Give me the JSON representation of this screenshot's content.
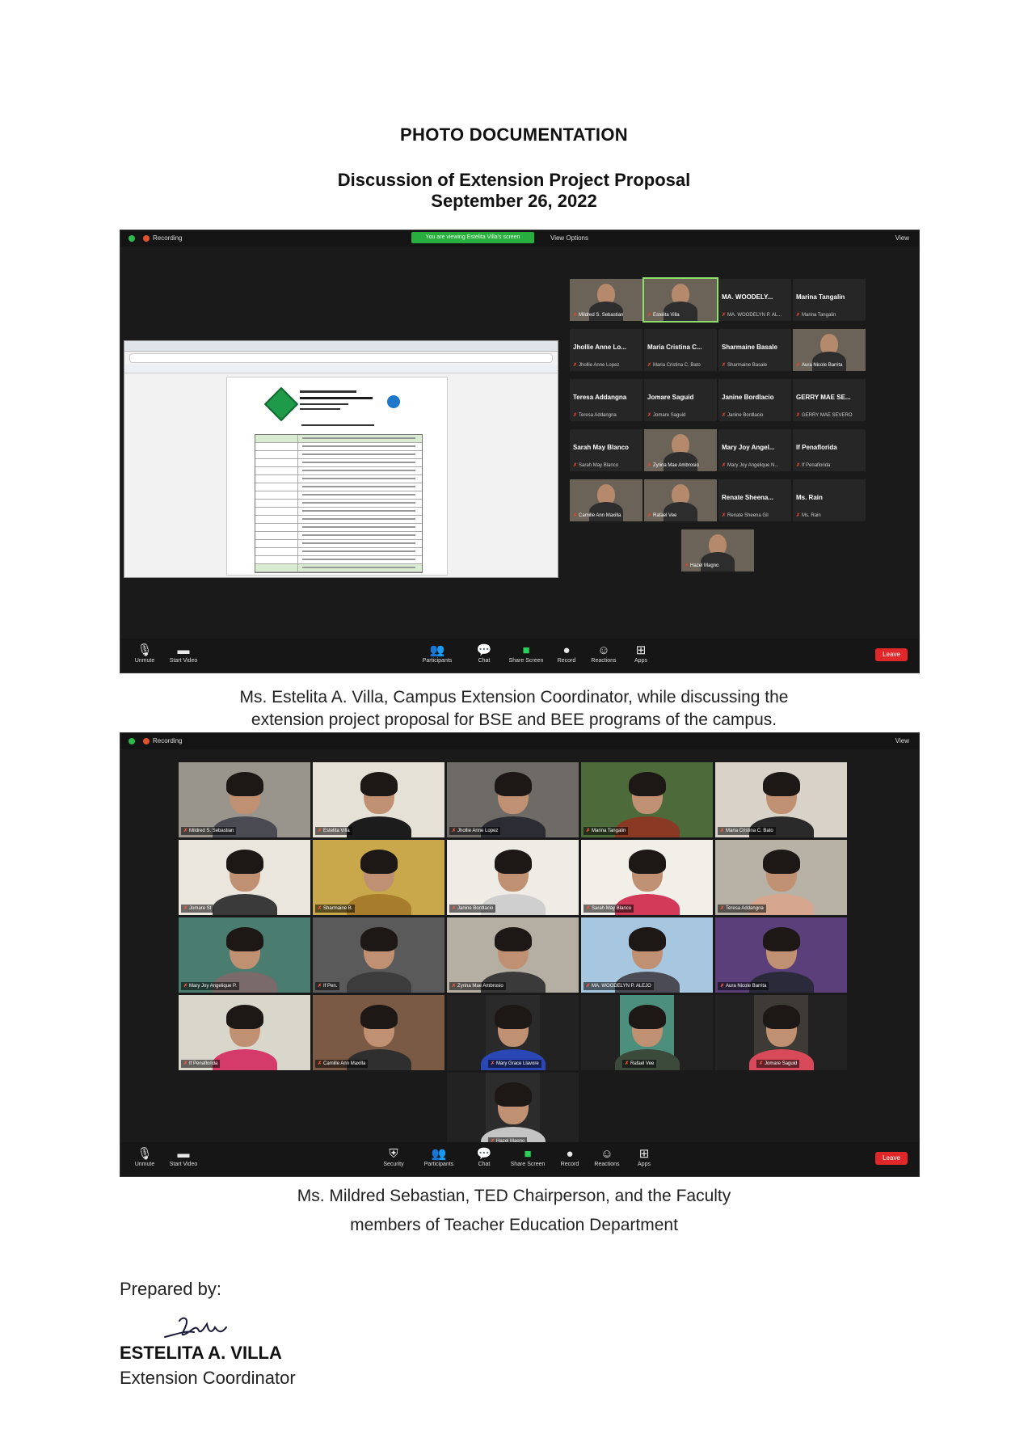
{
  "header": {
    "title": "PHOTO DOCUMENTATION",
    "subtitle_1": "Discussion of Extension Project Proposal",
    "subtitle_2": "September 26, 2022"
  },
  "screenshot_1": {
    "top_bar": {
      "recording_label": "Recording",
      "share_banner": "You are viewing Estelita Villa's screen",
      "view_options": "View Options",
      "view_button": "View"
    },
    "participants": [
      {
        "name": "",
        "sub": "Mildred S. Sebastian",
        "video": true
      },
      {
        "name": "",
        "sub": "Estelita Villa",
        "video": true,
        "active": true
      },
      {
        "name": "MA. WOODELY...",
        "sub": "MA. WOODELYN P. AL..."
      },
      {
        "name": "Marina Tangalin",
        "sub": "Marina Tangalin"
      },
      {
        "name": "Jhollie Anne Lo...",
        "sub": "Jhollie Anne Lopez"
      },
      {
        "name": "Maria Cristina C...",
        "sub": "Maria Cristina C. Bato"
      },
      {
        "name": "Sharmaine Basale",
        "sub": "Sharmaine Basale"
      },
      {
        "name": "",
        "sub": "Aura Nicole Barrita",
        "video": true
      },
      {
        "name": "Teresa Addangna",
        "sub": "Teresa Addangna"
      },
      {
        "name": "Jomare Saguid",
        "sub": "Jomare Saguid"
      },
      {
        "name": "Janine Bordlacio",
        "sub": "Janine Bordlacio"
      },
      {
        "name": "GERRY MAE SE...",
        "sub": "GERRY MAE SEVERO"
      },
      {
        "name": "Sarah May Blanco",
        "sub": "Sarah May Blanco"
      },
      {
        "name": "",
        "sub": "Zyrina Mae Ambrosio",
        "video": true
      },
      {
        "name": "Mary Joy Angel...",
        "sub": "Mary Joy Angelique N..."
      },
      {
        "name": "If Penaflorida",
        "sub": "If Penaflorida"
      },
      {
        "name": "",
        "sub": "Camille Ann Maxilla",
        "video": true
      },
      {
        "name": "",
        "sub": "Rafael Vee",
        "video": true
      },
      {
        "name": "Renate Sheena...",
        "sub": "Renate Sheena Gil"
      },
      {
        "name": "Ms. Rain",
        "sub": "Ms. Rain"
      },
      {
        "name": "",
        "sub": "Hazel Magno",
        "video": true
      }
    ],
    "toolbar": {
      "unmute": "Unmute",
      "start_video": "Start Video",
      "participants": "Participants",
      "chat": "Chat",
      "share_screen": "Share Screen",
      "record": "Record",
      "reactions": "Reactions",
      "apps": "Apps",
      "end": "Leave"
    }
  },
  "caption_1": {
    "line_1": "Ms. Estelita A. Villa, Campus Extension Coordinator, while discussing the",
    "line_2": "extension project proposal for BSE and BEE programs of the campus."
  },
  "screenshot_2": {
    "top_bar": {
      "recording_label": "Recording",
      "view_button": "View"
    },
    "gallery": [
      {
        "label": "Mildred S. Sebastian",
        "bg": "#9a958c",
        "shirt": "#4a4a52"
      },
      {
        "label": "Estelita Villa",
        "bg": "#e6e1d6",
        "shirt": "#1c1c1c"
      },
      {
        "label": "Jhollie Anne Lopez",
        "bg": "#6e6a66",
        "shirt": "#2c2c34"
      },
      {
        "label": "Marina Tangalin",
        "bg": "#4d6b3a",
        "shirt": "#8a3a24"
      },
      {
        "label": "Maria Cristina C. Bato",
        "bg": "#d8d2c8",
        "shirt": "#2a2a2a"
      },
      {
        "label": "Jomare SI",
        "bg": "#eae5dd",
        "shirt": "#3a3a3a"
      },
      {
        "label": "Sharmaine B.",
        "bg": "#c8a84a",
        "shirt": "#a77d2c"
      },
      {
        "label": "Janine Bordlacio",
        "bg": "#efece6",
        "shirt": "#cfcfcf"
      },
      {
        "label": "Sarah May Blanco",
        "bg": "#f2efe9",
        "shirt": "#d33a5a"
      },
      {
        "label": "Teresa Addangna",
        "bg": "#b8b2a6",
        "shirt": "#d6a68e"
      },
      {
        "label": "Mary Joy Angelique P.",
        "bg": "#4a7c70",
        "shirt": "#7a6a6a"
      },
      {
        "label": "If Pen.",
        "bg": "#5a5a5a",
        "shirt": "#3c3c3c"
      },
      {
        "label": "Zyrina Mae Ambrosio",
        "bg": "#b5aea2",
        "shirt": "#3a3a3a"
      },
      {
        "label": "MA. WOODELYN P. ALEJO",
        "bg": "#a7c6e0",
        "shirt": "#4b4b55"
      },
      {
        "label": "Aura Nicole Barrita",
        "bg": "#5a3f7a",
        "shirt": "#2a2a3a"
      },
      {
        "label": "If Penaflorida",
        "bg": "#d9d7cc",
        "shirt": "#d43a6a"
      },
      {
        "label": "Camille Ann Maxilla",
        "bg": "#7a5a44",
        "shirt": "#2f2f2f"
      },
      {
        "label": "Mary Grace Llavore",
        "bg": "#2a2a2a",
        "shirt": "#2b46b5",
        "narrow": true
      },
      {
        "label": "Rafael Vee",
        "bg": "#4c8f7c",
        "shirt": "#3b4a3a",
        "narrow": true
      },
      {
        "label": "Jomare Saguid",
        "bg": "#3e3a36",
        "shirt": "#d84a5a",
        "narrow": true
      },
      {
        "label": "Hazel Magno",
        "bg": "#2c2c2c",
        "shirt": "#c4c4c4",
        "narrow": true
      }
    ],
    "toolbar": {
      "unmute": "Unmute",
      "start_video": "Start Video",
      "security": "Security",
      "participants": "Participants",
      "chat": "Chat",
      "share_screen": "Share Screen",
      "record": "Record",
      "reactions": "Reactions",
      "apps": "Apps",
      "end": "Leave"
    }
  },
  "caption_2": {
    "line_1": "Ms. Mildred Sebastian, TED Chairperson, and the Faculty",
    "line_2": "members of Teacher Education Department"
  },
  "footer": {
    "prepared_by": "Prepared by:",
    "name": "ESTELITA A. VILLA",
    "role": "Extension Coordinator"
  }
}
